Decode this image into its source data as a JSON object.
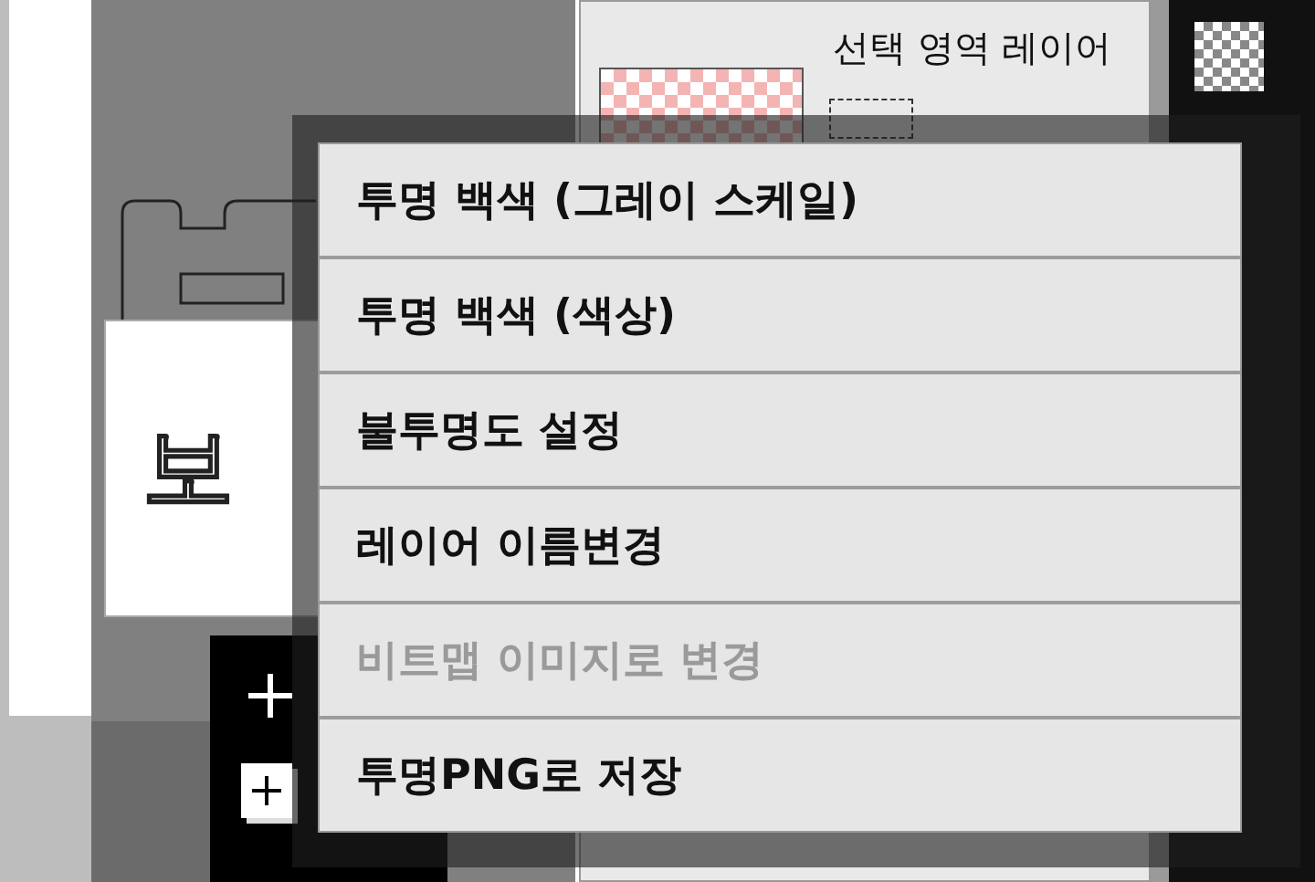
{
  "canvas": {
    "text": "보"
  },
  "layer_panel": {
    "title": "선택 영역 레이어"
  },
  "menu": {
    "items": [
      {
        "label": "투명 백색 (그레이 스케일)",
        "disabled": false
      },
      {
        "label": "투명 백색 (색상)",
        "disabled": false
      },
      {
        "label": "불투명도 설정",
        "disabled": false
      },
      {
        "label": "레이어 이름변경",
        "disabled": false
      },
      {
        "label": "비트맵 이미지로 변경",
        "disabled": true
      },
      {
        "label": "투명PNG로 저장",
        "disabled": false
      }
    ]
  }
}
